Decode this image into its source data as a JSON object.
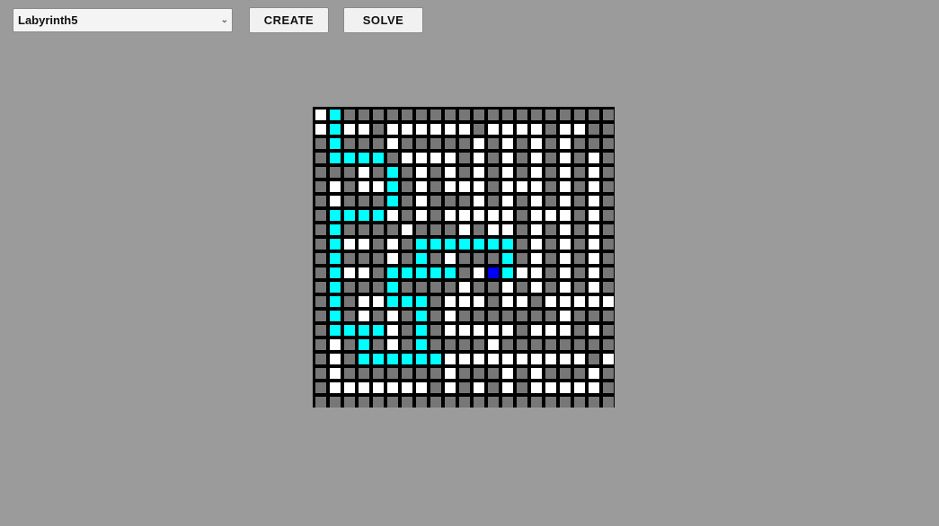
{
  "toolbar": {
    "maze_select": {
      "selected": "Labyrinth5"
    },
    "create_label": "CREATE",
    "solve_label": "SOLVE"
  },
  "colors": {
    "background": "#9b9b9b",
    "wall": "#777777",
    "open": "#ffffff",
    "path": "#00ffff",
    "current": "#0000ff",
    "grid_line": "#000000"
  },
  "maze": {
    "rows": 21,
    "cols": 21,
    "legend": {
      "#": "wall",
      ".": "open",
      "c": "path",
      "b": "current"
    },
    "grid": [
      ".c###################",
      ".c..#......#....#..##",
      "#c###.#####.#.#.#.###",
      "#cccc#....#.#.#.#.#.#",
      "###.#c#.#.#.#.#.#.#.#",
      "#.#..c#.#...#...#.#.#",
      "#.###c#.###.#.#.#.#.#",
      "#cccc.#.#.....#...#.#",
      "#c####.###.#..#.#.#.#",
      "#c..#.#ccccccc#.#.#.#",
      "#c###.#c#.###c#.#.#.#",
      "#c..#ccccc#.bc..#.#.#",
      "#c###c####.##.#.#.#.#",
      "#c#..ccc#...#..#.....",
      "#c#.#.#c#.#######.###",
      "#cccc.#c#.....#...#.#",
      "#.#c#.#c####.########",
      "#.#cccccc..........#.",
      "#.#######.###.#.###.#",
      "#.......#.#.#.#.....#",
      "#####################"
    ]
  }
}
